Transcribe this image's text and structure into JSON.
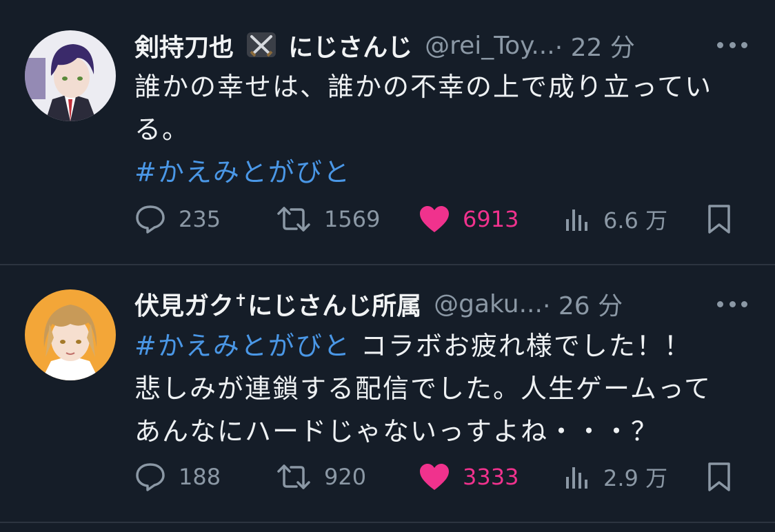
{
  "tweets": [
    {
      "display_name": "剣持刀也⚔️にじさんじ",
      "name_text": "剣持刀也",
      "name_suffix": "にじさんじ",
      "handle": "@rei_Toy...",
      "time": "· 22 分",
      "body_lines": [
        "誰かの幸せは、誰かの不幸の上で成り立ってい",
        "る。"
      ],
      "hashtag": "#かえみとがびと",
      "stats": {
        "replies": "235",
        "retweets": "1569",
        "likes": "6913",
        "views": "6.6 万"
      },
      "liked": true,
      "avatar_colors": {
        "bg": "#e8e8f0",
        "hair": "#3a2a6a",
        "skin": "#f2ddd2"
      }
    },
    {
      "display_name": "伏見ガク✝にじさんじ所属",
      "name_text": "伏見ガク",
      "name_mark": "✝",
      "name_suffix": "にじさんじ所属",
      "handle": "@gaku...",
      "time": "· 26 分",
      "hashtag": "#かえみとがびと",
      "body_first_rest": " コラボお疲れ様でした！！",
      "body_lines": [
        "悲しみが連鎖する配信でした。人生ゲームって",
        "あんなにハードじゃないっすよね・・・？"
      ],
      "stats": {
        "replies": "188",
        "retweets": "920",
        "likes": "3333",
        "views": "2.9 万"
      },
      "liked": true,
      "avatar_colors": {
        "bg": "#f3a638",
        "hair": "#c89a58",
        "skin": "#f6dfcf"
      }
    }
  ],
  "icons": [
    "reply-icon",
    "retweet-icon",
    "heart-icon",
    "views-icon",
    "bookmark-icon",
    "more-icon",
    "swords-icon"
  ],
  "colors": {
    "background": "#151d28",
    "muted": "#8b98a5",
    "link": "#4a97e6",
    "like": "#f0328d"
  }
}
